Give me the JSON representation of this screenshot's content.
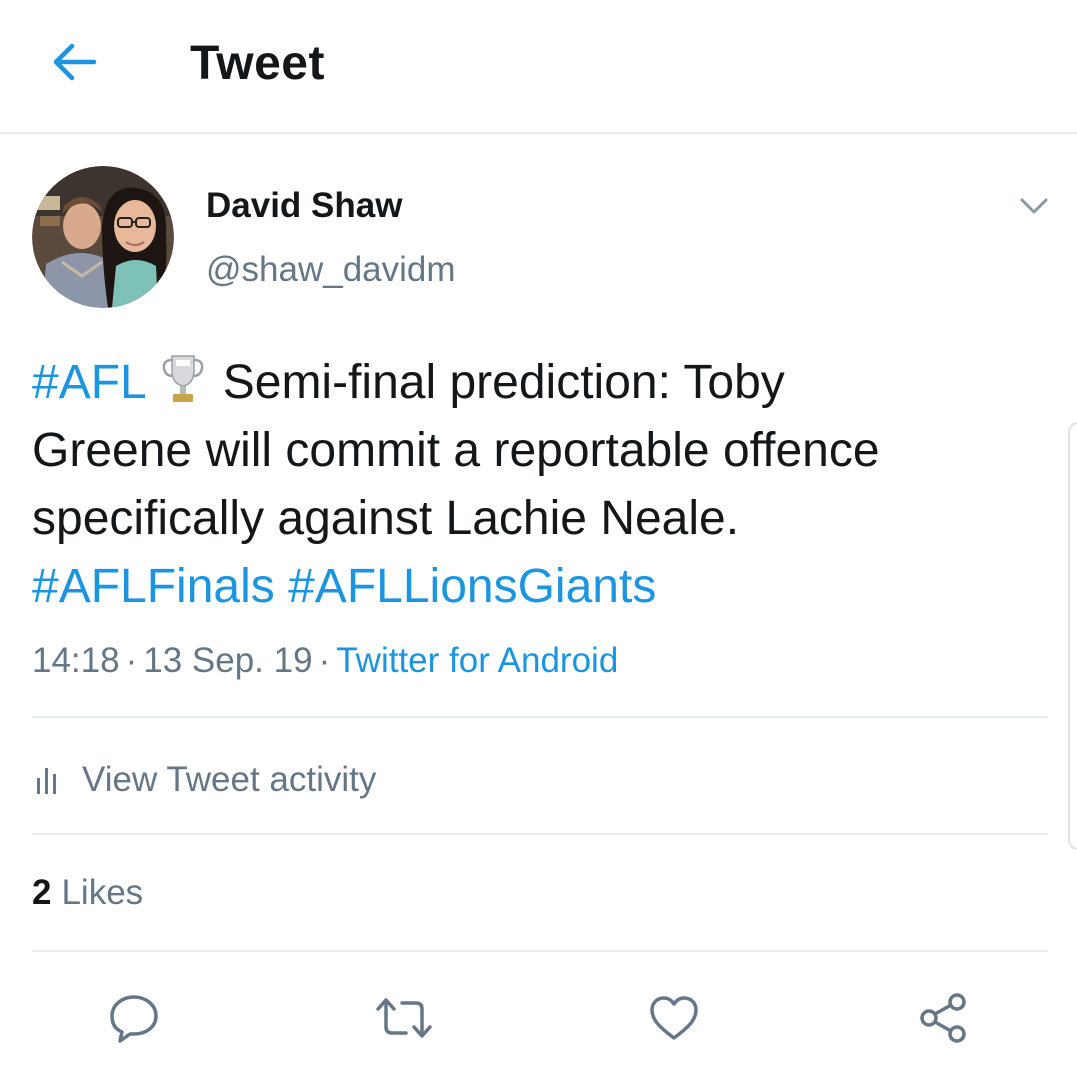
{
  "header": {
    "title": "Tweet",
    "back_icon": "arrow-left-icon"
  },
  "author": {
    "name": "David Shaw",
    "handle": "@shaw_davidm"
  },
  "tweet": {
    "line1": {
      "hashtag": "#AFL",
      "emoji": "trophy",
      "text": "Semi-final prediction: Toby"
    },
    "line2": "Greene will commit a reportable offence",
    "line3": "specifically against Lachie Neale.",
    "line4": {
      "hashtag1": "#AFLFinals",
      "hashtag2": "#AFLLionsGiants"
    }
  },
  "meta": {
    "time": "14:18",
    "date": "13 Sep. 19",
    "separator": "·",
    "source": "Twitter for Android"
  },
  "activity": {
    "label": "View Tweet activity",
    "icon": "bar-chart-icon"
  },
  "likes": {
    "count": "2",
    "label": "Likes"
  },
  "actions": {
    "reply_icon": "reply-icon",
    "retweet_icon": "retweet-icon",
    "like_icon": "heart-icon",
    "share_icon": "share-icon"
  },
  "colors": {
    "accent": "#1b95e0",
    "text": "#14171a",
    "secondary": "#657786",
    "divider": "#e6ecf0"
  }
}
